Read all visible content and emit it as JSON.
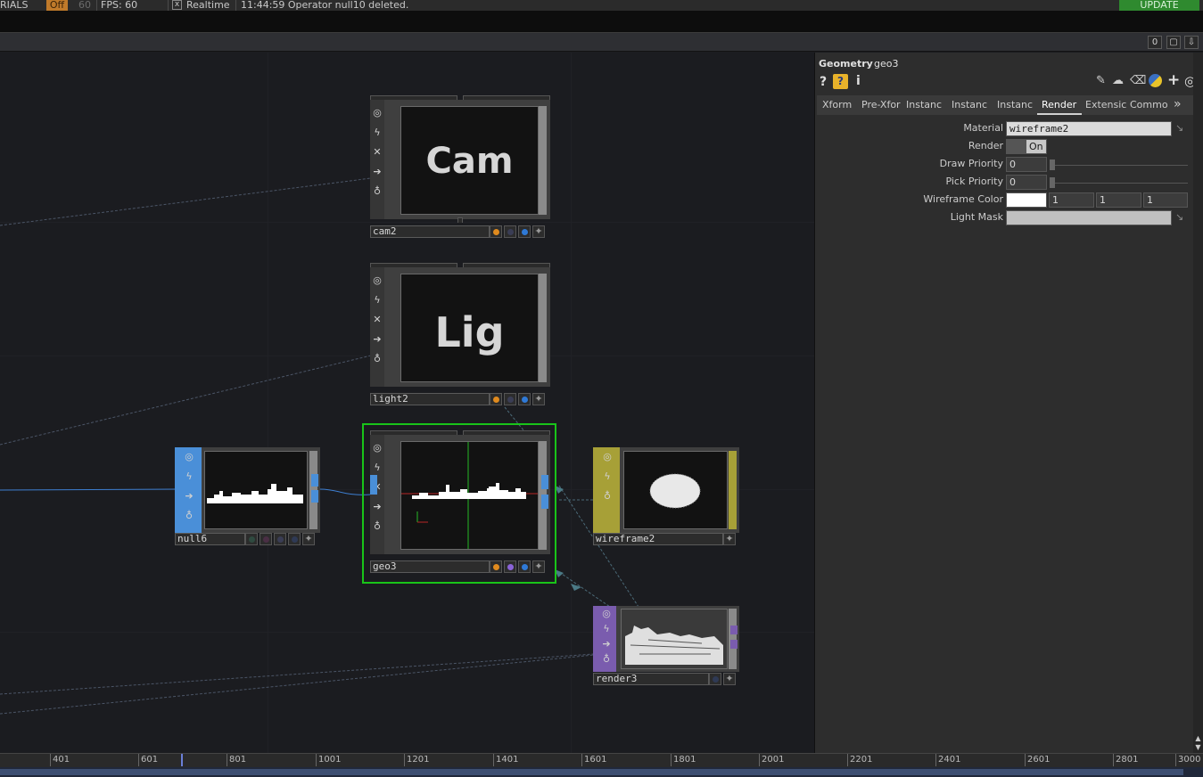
{
  "topbar": {
    "tutorials": "RIALS",
    "opt_badge": "Off",
    "fps_value_dim": "60",
    "fps_label": "FPS:  60",
    "realtime_checkbox": "x",
    "realtime_label": "Realtime",
    "status_message": "11:44:59 Operator null10 deleted.",
    "update_button": "UPDATE"
  },
  "pathbar": {
    "count": "0",
    "panel_icon": "▢",
    "pin_icon": "⇩"
  },
  "nodes": {
    "cam2": {
      "name": "cam2",
      "viewer_text": "Cam"
    },
    "light2": {
      "name": "light2",
      "viewer_text": "Lig"
    },
    "geo3": {
      "name": "geo3"
    },
    "null6": {
      "name": "null6"
    },
    "wireframe2": {
      "name": "wireframe2"
    },
    "render3": {
      "name": "render3"
    }
  },
  "colors": {
    "selected_outline": "#19c419",
    "flag_orange": "#e08a1e",
    "flag_blue": "#2f79d6",
    "flag_purple": "#8a63d6",
    "sop_blue": "#4a8fd8",
    "mat_yellow": "#a7a037",
    "top_purple": "#7a5cae"
  },
  "params": {
    "op_type": "Geometry",
    "op_name": "geo3",
    "tabs": [
      "Xform",
      "Pre-Xfor",
      "Instanc",
      "Instanc",
      "Instanc",
      "Render",
      "Extensic",
      "Commo"
    ],
    "more_tabs": "»",
    "active_tab": "Render",
    "rows": {
      "material": {
        "label": "Material",
        "value": "wireframe2"
      },
      "render": {
        "label": "Render",
        "value": "On"
      },
      "draw_priority": {
        "label": "Draw Priority",
        "value": "0"
      },
      "pick_priority": {
        "label": "Pick Priority",
        "value": "0"
      },
      "wireframe_color": {
        "label": "Wireframe Color",
        "r": "1",
        "g": "1",
        "b": "1"
      },
      "light_mask": {
        "label": "Light Mask",
        "value": ""
      }
    }
  },
  "timeline": {
    "ticks": [
      "401",
      "601",
      "801",
      "1001",
      "1201",
      "1401",
      "1601",
      "1801",
      "2001",
      "2201",
      "2401",
      "2601",
      "2801",
      "3000"
    ]
  }
}
